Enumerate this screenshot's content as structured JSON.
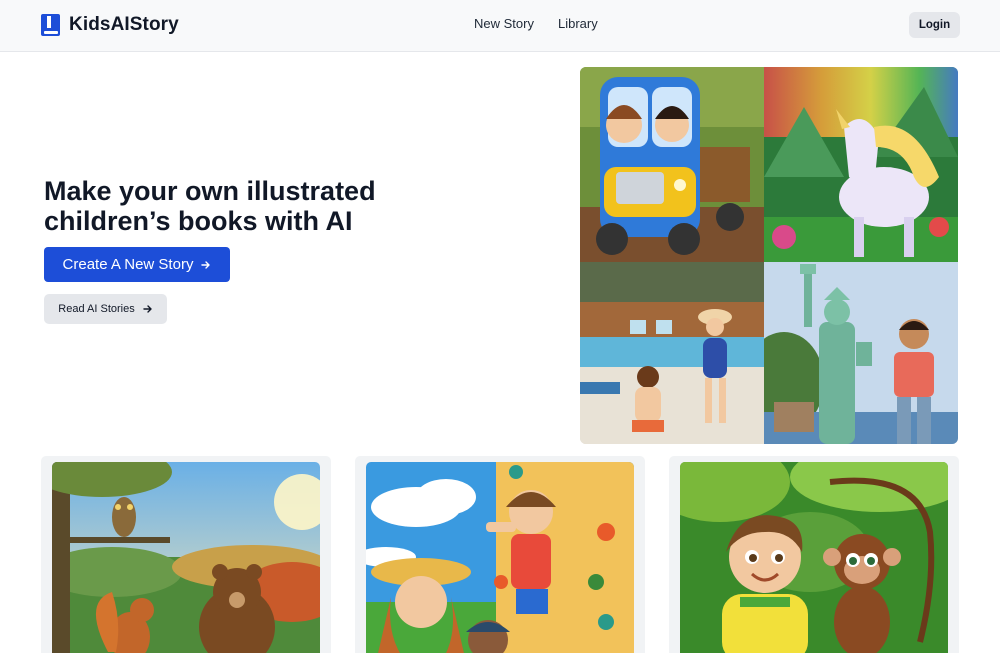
{
  "header": {
    "brand": "KidsAIStory",
    "nav": [
      {
        "label": "New Story"
      },
      {
        "label": "Library"
      }
    ],
    "login_label": "Login"
  },
  "hero": {
    "title_line1": "Make your own illustrated",
    "title_line2": "children’s books with AI",
    "primary_cta": "Create A New Story",
    "secondary_cta": "Read AI Stories"
  },
  "collage": [
    {
      "icon": "truck-kids-illustration"
    },
    {
      "icon": "unicorn-illustration"
    },
    {
      "icon": "pool-kids-illustration"
    },
    {
      "icon": "statue-of-liberty-boy-illustration"
    }
  ],
  "cards": [
    {
      "icon": "forest-animals-illustration"
    },
    {
      "icon": "climbing-wall-illustration"
    },
    {
      "icon": "boy-monkey-illustration"
    }
  ],
  "colors": {
    "accent": "#1d4ed8",
    "header_bg": "#f8f9fa",
    "button_gray": "#e5e7eb"
  }
}
